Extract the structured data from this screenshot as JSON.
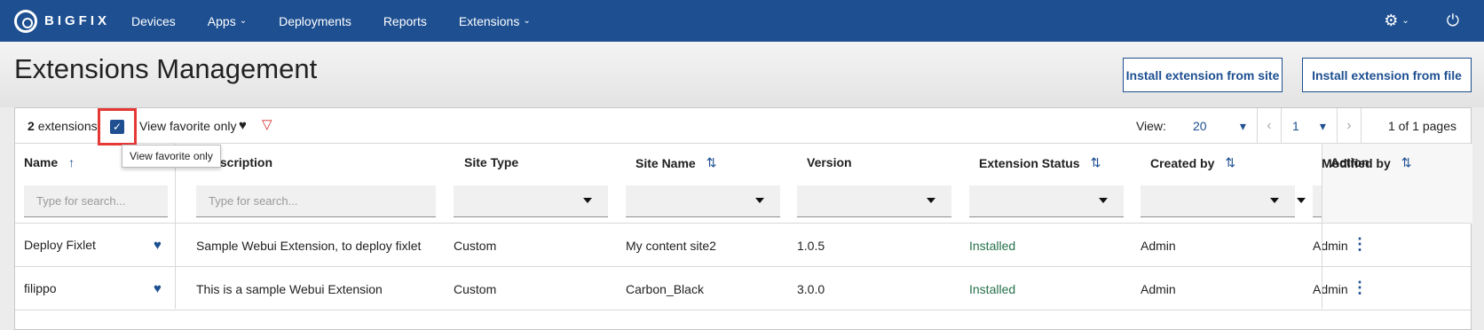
{
  "nav": {
    "brand": "BIGFIX",
    "items": [
      {
        "label": "Devices",
        "has_menu": false
      },
      {
        "label": "Apps",
        "has_menu": true
      },
      {
        "label": "Deployments",
        "has_menu": false
      },
      {
        "label": "Reports",
        "has_menu": false
      },
      {
        "label": "Extensions",
        "has_menu": true
      }
    ],
    "settings_icon": "gear-icon",
    "power_icon": "power-icon"
  },
  "page": {
    "title": "Extensions Management",
    "install_site_label": "Install extension from site",
    "install_file_label": "Install extension from file"
  },
  "toolbar": {
    "count": "2",
    "count_suffix": "extensions",
    "fav_label": "View favorite only",
    "tooltip": "View favorite only",
    "view_label": "View:",
    "per_page": "20",
    "page": "1",
    "page_total": "1 of 1 pages"
  },
  "table": {
    "columns": [
      "Name",
      "Description",
      "Site Type",
      "Site Name",
      "Version",
      "Extension Status",
      "Created by",
      "Modified by",
      "Action"
    ],
    "search_placeholder": "Type for search...",
    "rows": [
      {
        "name": "Deploy Fixlet",
        "description": "Sample Webui Extension, to deploy fixlet",
        "site_type": "Custom",
        "site_name": "My content site2",
        "version": "1.0.5",
        "status": "Installed",
        "created_by": "Admin",
        "modified_by": "Admin",
        "favorite": true
      },
      {
        "name": "filippo",
        "description": "This is a sample Webui Extension",
        "site_type": "Custom",
        "site_name": "Carbon_Black",
        "version": "3.0.0",
        "status": "Installed",
        "created_by": "Admin",
        "modified_by": "Admin",
        "favorite": true
      }
    ]
  },
  "colors": {
    "nav_bg": "#1d4f91",
    "accent": "#1d4f91",
    "status_installed": "#24704b",
    "highlight_box": "#e53935"
  }
}
